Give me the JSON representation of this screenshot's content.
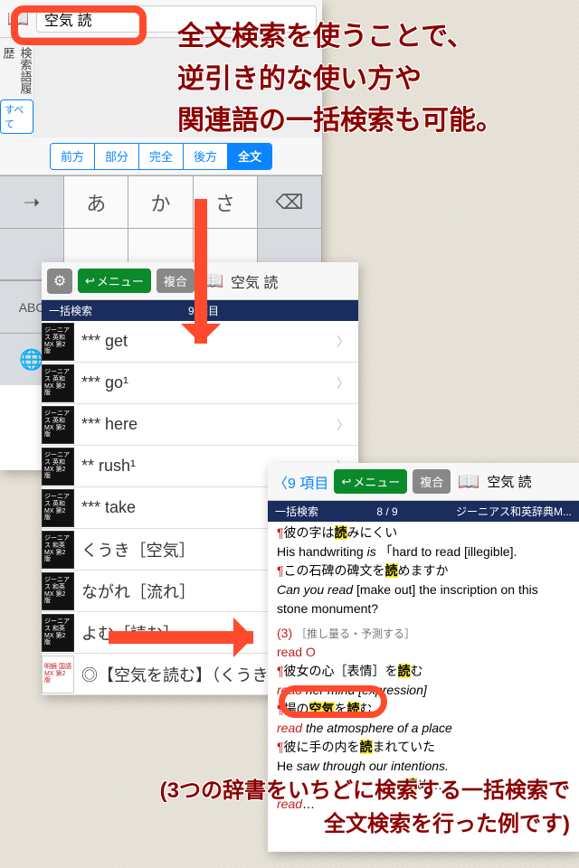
{
  "panel1": {
    "search": "空気 読",
    "history_label": "検索語履歴",
    "filter_label": "すべて",
    "segments": [
      "前方",
      "部分",
      "完全",
      "後方",
      "全文"
    ],
    "kb": {
      "a": "あ",
      "ka": "か",
      "sa": "さ",
      "abc": "ABC",
      "globe": "🌐"
    }
  },
  "panel2": {
    "menu": "メニュー",
    "mode": "複合",
    "search": "空気 読",
    "banner_left": "一括検索",
    "banner_right": "9 項目",
    "dict_ej": "ジーニアス\n英和MX\n第2版",
    "dict_je": "ジーニアス\n和英MX\n第2版",
    "dict_mk": "明鏡\n国語MX\n第2版",
    "items": [
      "*** get",
      "*** go¹",
      "*** here",
      "** rush¹",
      "*** take",
      "くうき［空気］",
      "ながれ［流れ］",
      "よむ［読む］",
      "◎【空気を読む】（くうき"
    ]
  },
  "panel3": {
    "back": "9 項目",
    "menu": "メニュー",
    "mode": "複合",
    "search": "空気 読",
    "banner_left": "一括検索",
    "banner_mid": "8 / 9",
    "banner_right": "ジーニアス和英辞典M...",
    "l1_a": "彼の字は",
    "l1_b": "みにくい",
    "l1_hl": "読",
    "l2": "His handwriting ",
    "l2_i": "is",
    "l2_q": "「hard to read [illegible].",
    "l3a": "この石碑の碑文を",
    "l3b": "めますか",
    "l3hl": "読",
    "l4a": "Can you read ",
    "l4b": "[make out]",
    "l4c": " the inscription on this stone monument?",
    "l5a": "(3)",
    "l5b": "［推し量る・予測する］",
    "l6": "read O",
    "l7a": "彼女の心［表情］を",
    "l7hl": "読",
    "l7b": "む",
    "l8a": "read",
    "l8b": " her mind [expression]",
    "l9a": "場の",
    "l9b": "空気",
    "l9c": "を",
    "l9d": "読",
    "l9e": "む",
    "l10a": "read",
    "l10b": " the atmosphere of a place",
    "l11a": "彼に手の内を",
    "l11hl": "読",
    "l11b": "まれていた",
    "l12a": "He ",
    "l12b": "saw through our intentions.",
    "l13hl": "読",
    "l14": "read"
  },
  "callouts": {
    "top": "全文検索を使うことで、\n逆引き的な使い方や\n関連語の一括検索も可能。",
    "bottom": "(3つの辞書をいちどに検索する一括検索で\n全文検索を行った例です)"
  }
}
